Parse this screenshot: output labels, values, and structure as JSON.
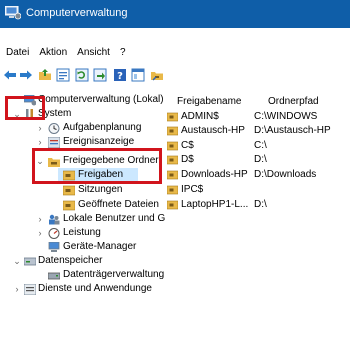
{
  "window": {
    "title": "Computerverwaltung"
  },
  "menu": [
    "Datei",
    "Aktion",
    "Ansicht",
    "?"
  ],
  "toolbar": {
    "buttons": [
      "back-arrow-icon",
      "forward-arrow-icon",
      "folder-up-icon",
      "properties-icon",
      "refresh-icon",
      "export-icon",
      "help-icon",
      "view-icon",
      "share-folder-icon"
    ]
  },
  "tree": {
    "root": "Computerverwaltung (Lokal)",
    "system": "System",
    "aufgabenplanung": "Aufgabenplanung",
    "ereignisanzeige": "Ereignisanzeige",
    "freigegebene_ordner": "Freigegebene Ordner",
    "freigaben": "Freigaben",
    "sitzungen": "Sitzungen",
    "geoeffnete_dateien": "Geöffnete Dateien",
    "lokale_benutzer": "Lokale Benutzer und G",
    "leistung": "Leistung",
    "geraete_manager": "Geräte-Manager",
    "datenspeicher": "Datenspeicher",
    "datentraegerverwaltung": "Datenträgerverwaltung",
    "dienste": "Dienste und Anwendunge"
  },
  "list": {
    "columns": [
      "Freigabename",
      "Ordnerpfad"
    ],
    "rows": [
      {
        "name": "ADMIN$",
        "path": "C:\\WINDOWS"
      },
      {
        "name": "Austausch-HP",
        "path": "D:\\Austausch-HP"
      },
      {
        "name": "C$",
        "path": "C:\\"
      },
      {
        "name": "D$",
        "path": "D:\\"
      },
      {
        "name": "Downloads-HP",
        "path": "D:\\Downloads"
      },
      {
        "name": "IPC$",
        "path": ""
      },
      {
        "name": "LaptopHP1-L...",
        "path": "D:\\"
      }
    ]
  },
  "colors": {
    "titlebar": "#0f5ea8",
    "selection": "#cce8ff",
    "highlight_box": "#d1141c"
  }
}
